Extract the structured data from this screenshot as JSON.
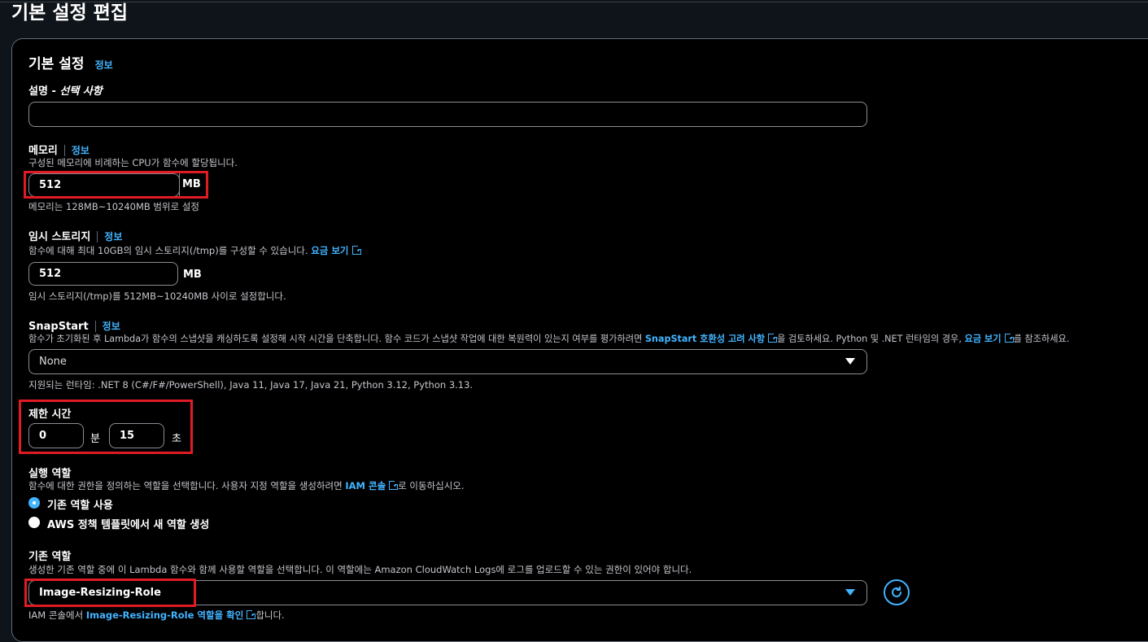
{
  "page": {
    "title": "기본 설정 편집"
  },
  "section": {
    "title": "기본 설정",
    "info": "정보"
  },
  "description_field": {
    "label": "설명",
    "label_suffix": "선택 사항",
    "value": ""
  },
  "memory": {
    "label": "메모리",
    "info": "정보",
    "desc": "구성된 메모리에 비례하는 CPU가 함수에 할당됩니다.",
    "value": "512",
    "unit": "MB",
    "hint": "메모리는 128MB~10240MB 범위로 설정"
  },
  "ephemeral": {
    "label": "임시 스토리지",
    "info": "정보",
    "desc": "함수에 대해 최대 10GB의 임시 스토리지(/tmp)를 구성할 수 있습니다.",
    "link": "요금 보기",
    "value": "512",
    "unit": "MB",
    "hint": "임시 스토리지(/tmp)를 512MB~10240MB 사이로 설정합니다."
  },
  "snapstart": {
    "label": "SnapStart",
    "info": "정보",
    "desc_1": "함수가 초기화된 후 Lambda가 함수의 스냅샷을 캐싱하도록 설정해 시작 시간을 단축합니다. 함수 코드가 스냅샷 작업에 대한 복원력이 있는지 여부를 평가하려면",
    "link_1": "SnapStart 호환성 고려 사항",
    "desc_2": "을 검토하세요. Python 및 .NET 런타임의 경우,",
    "link_2": "요금 보기",
    "desc_3": "를 참조하세요.",
    "selected": "None",
    "hint": "지원되는 런타임: .NET 8 (C#/F#/PowerShell), Java 11, Java 17, Java 21, Python 3.12, Python 3.13."
  },
  "timeout": {
    "label": "제한 시간",
    "minutes": "0",
    "minutes_unit": "분",
    "seconds": "15",
    "seconds_unit": "초"
  },
  "execution_role": {
    "label": "실행 역할",
    "desc_1": "함수에 대한 권한을 정의하는 역할을 선택합니다. 사용자 지정 역할을 생성하려면",
    "link": "IAM 콘솔",
    "desc_2": "로 이동하십시오.",
    "options": [
      "기존 역할 사용",
      "AWS 정책 템플릿에서 새 역할 생성"
    ],
    "selected_index": 0
  },
  "existing_role": {
    "label": "기존 역할",
    "desc": "생성한 기존 역할 중에 이 Lambda 함수와 함께 사용할 역할을 선택합니다. 이 역할에는 Amazon CloudWatch Logs에 로그를 업로드할 수 있는 권한이 있어야 합니다.",
    "selected": "Image-Resizing-Role",
    "hint_1": "IAM 콘솔에서",
    "hint_link": "Image-Resizing-Role 역할을 확인",
    "hint_2": "합니다."
  },
  "colors": {
    "accent": "#42b4ff",
    "highlight": "#e01b24",
    "background": "#000000"
  }
}
